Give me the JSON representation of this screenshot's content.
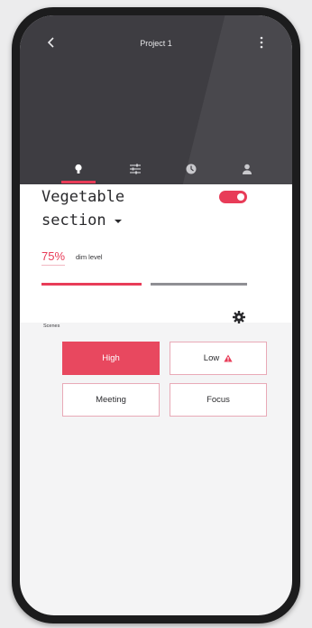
{
  "header": {
    "title": "Project 1",
    "back_icon": "chevron-left-icon",
    "more_icon": "more-vertical-icon"
  },
  "tabs": [
    {
      "icon": "lightbulb-icon",
      "active": true
    },
    {
      "icon": "sliders-icon",
      "active": false
    },
    {
      "icon": "clock-icon",
      "active": false
    },
    {
      "icon": "person-icon",
      "active": false
    }
  ],
  "section": {
    "name_line1": "Vegetable",
    "name_line2": "section",
    "enabled": true
  },
  "dim": {
    "value_text": "75%",
    "label": "dim level",
    "level": 0.5
  },
  "scenes": {
    "label": "Scenes",
    "settings_icon": "gear-icon",
    "items": [
      {
        "label": "High",
        "active": true,
        "warning": false
      },
      {
        "label": "Low",
        "active": false,
        "warning": true
      },
      {
        "label": "Meeting",
        "active": false,
        "warning": false
      },
      {
        "label": "Focus",
        "active": false,
        "warning": false
      }
    ]
  },
  "colors": {
    "accent": "#e83c58",
    "header_bg": "#3e3d42",
    "screen_bg": "#f4f4f5"
  }
}
